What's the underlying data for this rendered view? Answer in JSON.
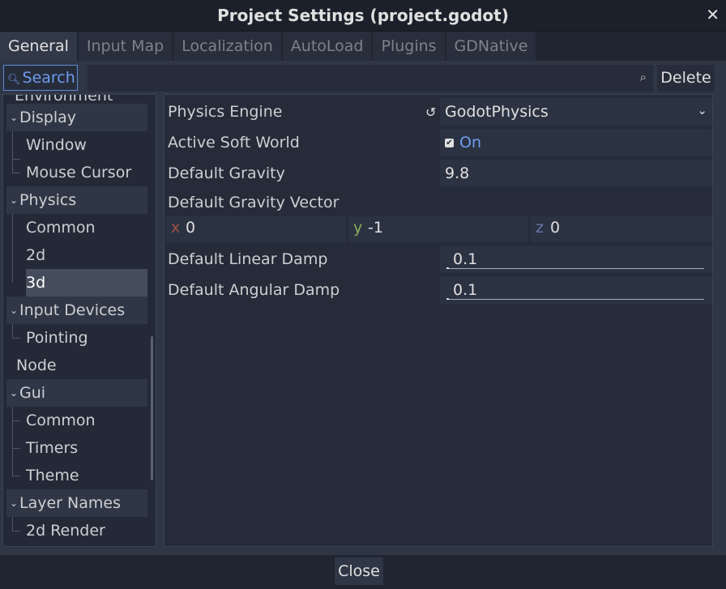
{
  "window": {
    "title": "Project Settings (project.godot)",
    "close_glyph": "✕"
  },
  "tabs": [
    {
      "label": "General"
    },
    {
      "label": "Input Map"
    },
    {
      "label": "Localization"
    },
    {
      "label": "AutoLoad"
    },
    {
      "label": "Plugins"
    },
    {
      "label": "GDNative"
    }
  ],
  "search": {
    "label": "Search",
    "icon": "search-icon",
    "placeholder": ""
  },
  "delete_label": "Delete",
  "tree": {
    "clipped_text": "Environment",
    "items": [
      {
        "label": "Display"
      },
      {
        "label": "Window"
      },
      {
        "label": "Mouse Cursor"
      },
      {
        "label": "Physics"
      },
      {
        "label": "Common"
      },
      {
        "label": "2d"
      },
      {
        "label": "3d"
      },
      {
        "label": "Input Devices"
      },
      {
        "label": "Pointing"
      },
      {
        "label": "Node"
      },
      {
        "label": "Gui"
      },
      {
        "label": "Common"
      },
      {
        "label": "Timers"
      },
      {
        "label": "Theme"
      },
      {
        "label": "Layer Names"
      },
      {
        "label": "2d Render"
      }
    ]
  },
  "inspector": {
    "physics_engine": {
      "label": "Physics Engine",
      "value": "GodotPhysics"
    },
    "active_soft_world": {
      "label": "Active Soft World",
      "value": "On",
      "checked": true
    },
    "default_gravity": {
      "label": "Default Gravity",
      "value": "9.8"
    },
    "default_gravity_vector": {
      "label": "Default Gravity Vector",
      "x_label": "x",
      "x": "0",
      "y_label": "y",
      "y": "-1",
      "z_label": "z",
      "z": "0"
    },
    "default_linear_damp": {
      "label": "Default Linear Damp",
      "value": "0.1"
    },
    "default_angular_damp": {
      "label": "Default Angular Damp",
      "value": "0.1"
    }
  },
  "footer": {
    "close_label": "Close"
  },
  "colors": {
    "accent": "#6f9dee",
    "background": "#202531",
    "panel": "#2f3645"
  }
}
